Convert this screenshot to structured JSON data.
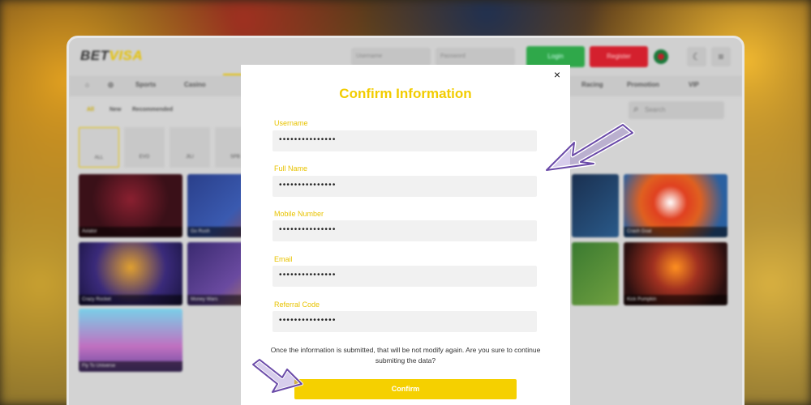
{
  "site": {
    "logo_bet": "BET",
    "logo_visa": "VISA",
    "username_placeholder": "Username",
    "password_placeholder": "Password",
    "login": "Login",
    "register": "Register",
    "nav": [
      "Sports",
      "Casino",
      "Racing",
      "Promotion",
      "VIP"
    ],
    "filters": [
      "All",
      "New",
      "Recommended"
    ],
    "search_placeholder": "Search",
    "providers": [
      "ALL",
      "EVO",
      "JILI",
      "SPB"
    ],
    "games": [
      "Aviator",
      "Go Rush",
      "Crazy Rocket",
      "Money Wars",
      "Fly To Universe",
      "Crash Goal",
      "Kick Pumpkin"
    ]
  },
  "modal": {
    "title": "Confirm Information",
    "close": "×",
    "fields": [
      {
        "label": "Username",
        "value": "•••••••••••••••"
      },
      {
        "label": "Full Name",
        "value": "•••••••••••••••"
      },
      {
        "label": "Mobile Number",
        "value": "•••••••••••••••"
      },
      {
        "label": "Email",
        "value": "•••••••••••••••"
      },
      {
        "label": "Referral Code",
        "value": "•••••••••••••••"
      }
    ],
    "notice": "Once the information is submitted, that will be not modify again. Are you sure to continue submiting the data?",
    "confirm": "Confirm"
  },
  "colors": {
    "accent": "#f2cc00",
    "login": "#2fa84a",
    "register": "#d4202e",
    "arrow": "#9a7fd0"
  }
}
